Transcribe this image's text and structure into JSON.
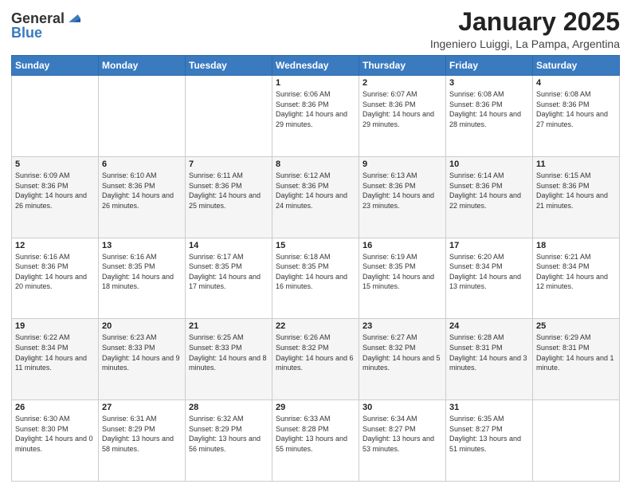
{
  "logo": {
    "general": "General",
    "blue": "Blue"
  },
  "title": {
    "month": "January 2025",
    "location": "Ingeniero Luiggi, La Pampa, Argentina"
  },
  "days": [
    "Sunday",
    "Monday",
    "Tuesday",
    "Wednesday",
    "Thursday",
    "Friday",
    "Saturday"
  ],
  "weeks": [
    [
      {
        "date": "",
        "sunrise": "",
        "sunset": "",
        "daylight": ""
      },
      {
        "date": "",
        "sunrise": "",
        "sunset": "",
        "daylight": ""
      },
      {
        "date": "",
        "sunrise": "",
        "sunset": "",
        "daylight": ""
      },
      {
        "date": "1",
        "sunrise": "Sunrise: 6:06 AM",
        "sunset": "Sunset: 8:36 PM",
        "daylight": "Daylight: 14 hours and 29 minutes."
      },
      {
        "date": "2",
        "sunrise": "Sunrise: 6:07 AM",
        "sunset": "Sunset: 8:36 PM",
        "daylight": "Daylight: 14 hours and 29 minutes."
      },
      {
        "date": "3",
        "sunrise": "Sunrise: 6:08 AM",
        "sunset": "Sunset: 8:36 PM",
        "daylight": "Daylight: 14 hours and 28 minutes."
      },
      {
        "date": "4",
        "sunrise": "Sunrise: 6:08 AM",
        "sunset": "Sunset: 8:36 PM",
        "daylight": "Daylight: 14 hours and 27 minutes."
      }
    ],
    [
      {
        "date": "5",
        "sunrise": "Sunrise: 6:09 AM",
        "sunset": "Sunset: 8:36 PM",
        "daylight": "Daylight: 14 hours and 26 minutes."
      },
      {
        "date": "6",
        "sunrise": "Sunrise: 6:10 AM",
        "sunset": "Sunset: 8:36 PM",
        "daylight": "Daylight: 14 hours and 26 minutes."
      },
      {
        "date": "7",
        "sunrise": "Sunrise: 6:11 AM",
        "sunset": "Sunset: 8:36 PM",
        "daylight": "Daylight: 14 hours and 25 minutes."
      },
      {
        "date": "8",
        "sunrise": "Sunrise: 6:12 AM",
        "sunset": "Sunset: 8:36 PM",
        "daylight": "Daylight: 14 hours and 24 minutes."
      },
      {
        "date": "9",
        "sunrise": "Sunrise: 6:13 AM",
        "sunset": "Sunset: 8:36 PM",
        "daylight": "Daylight: 14 hours and 23 minutes."
      },
      {
        "date": "10",
        "sunrise": "Sunrise: 6:14 AM",
        "sunset": "Sunset: 8:36 PM",
        "daylight": "Daylight: 14 hours and 22 minutes."
      },
      {
        "date": "11",
        "sunrise": "Sunrise: 6:15 AM",
        "sunset": "Sunset: 8:36 PM",
        "daylight": "Daylight: 14 hours and 21 minutes."
      }
    ],
    [
      {
        "date": "12",
        "sunrise": "Sunrise: 6:16 AM",
        "sunset": "Sunset: 8:36 PM",
        "daylight": "Daylight: 14 hours and 20 minutes."
      },
      {
        "date": "13",
        "sunrise": "Sunrise: 6:16 AM",
        "sunset": "Sunset: 8:35 PM",
        "daylight": "Daylight: 14 hours and 18 minutes."
      },
      {
        "date": "14",
        "sunrise": "Sunrise: 6:17 AM",
        "sunset": "Sunset: 8:35 PM",
        "daylight": "Daylight: 14 hours and 17 minutes."
      },
      {
        "date": "15",
        "sunrise": "Sunrise: 6:18 AM",
        "sunset": "Sunset: 8:35 PM",
        "daylight": "Daylight: 14 hours and 16 minutes."
      },
      {
        "date": "16",
        "sunrise": "Sunrise: 6:19 AM",
        "sunset": "Sunset: 8:35 PM",
        "daylight": "Daylight: 14 hours and 15 minutes."
      },
      {
        "date": "17",
        "sunrise": "Sunrise: 6:20 AM",
        "sunset": "Sunset: 8:34 PM",
        "daylight": "Daylight: 14 hours and 13 minutes."
      },
      {
        "date": "18",
        "sunrise": "Sunrise: 6:21 AM",
        "sunset": "Sunset: 8:34 PM",
        "daylight": "Daylight: 14 hours and 12 minutes."
      }
    ],
    [
      {
        "date": "19",
        "sunrise": "Sunrise: 6:22 AM",
        "sunset": "Sunset: 8:34 PM",
        "daylight": "Daylight: 14 hours and 11 minutes."
      },
      {
        "date": "20",
        "sunrise": "Sunrise: 6:23 AM",
        "sunset": "Sunset: 8:33 PM",
        "daylight": "Daylight: 14 hours and 9 minutes."
      },
      {
        "date": "21",
        "sunrise": "Sunrise: 6:25 AM",
        "sunset": "Sunset: 8:33 PM",
        "daylight": "Daylight: 14 hours and 8 minutes."
      },
      {
        "date": "22",
        "sunrise": "Sunrise: 6:26 AM",
        "sunset": "Sunset: 8:32 PM",
        "daylight": "Daylight: 14 hours and 6 minutes."
      },
      {
        "date": "23",
        "sunrise": "Sunrise: 6:27 AM",
        "sunset": "Sunset: 8:32 PM",
        "daylight": "Daylight: 14 hours and 5 minutes."
      },
      {
        "date": "24",
        "sunrise": "Sunrise: 6:28 AM",
        "sunset": "Sunset: 8:31 PM",
        "daylight": "Daylight: 14 hours and 3 minutes."
      },
      {
        "date": "25",
        "sunrise": "Sunrise: 6:29 AM",
        "sunset": "Sunset: 8:31 PM",
        "daylight": "Daylight: 14 hours and 1 minute."
      }
    ],
    [
      {
        "date": "26",
        "sunrise": "Sunrise: 6:30 AM",
        "sunset": "Sunset: 8:30 PM",
        "daylight": "Daylight: 14 hours and 0 minutes."
      },
      {
        "date": "27",
        "sunrise": "Sunrise: 6:31 AM",
        "sunset": "Sunset: 8:29 PM",
        "daylight": "Daylight: 13 hours and 58 minutes."
      },
      {
        "date": "28",
        "sunrise": "Sunrise: 6:32 AM",
        "sunset": "Sunset: 8:29 PM",
        "daylight": "Daylight: 13 hours and 56 minutes."
      },
      {
        "date": "29",
        "sunrise": "Sunrise: 6:33 AM",
        "sunset": "Sunset: 8:28 PM",
        "daylight": "Daylight: 13 hours and 55 minutes."
      },
      {
        "date": "30",
        "sunrise": "Sunrise: 6:34 AM",
        "sunset": "Sunset: 8:27 PM",
        "daylight": "Daylight: 13 hours and 53 minutes."
      },
      {
        "date": "31",
        "sunrise": "Sunrise: 6:35 AM",
        "sunset": "Sunset: 8:27 PM",
        "daylight": "Daylight: 13 hours and 51 minutes."
      },
      {
        "date": "",
        "sunrise": "",
        "sunset": "",
        "daylight": ""
      }
    ]
  ]
}
